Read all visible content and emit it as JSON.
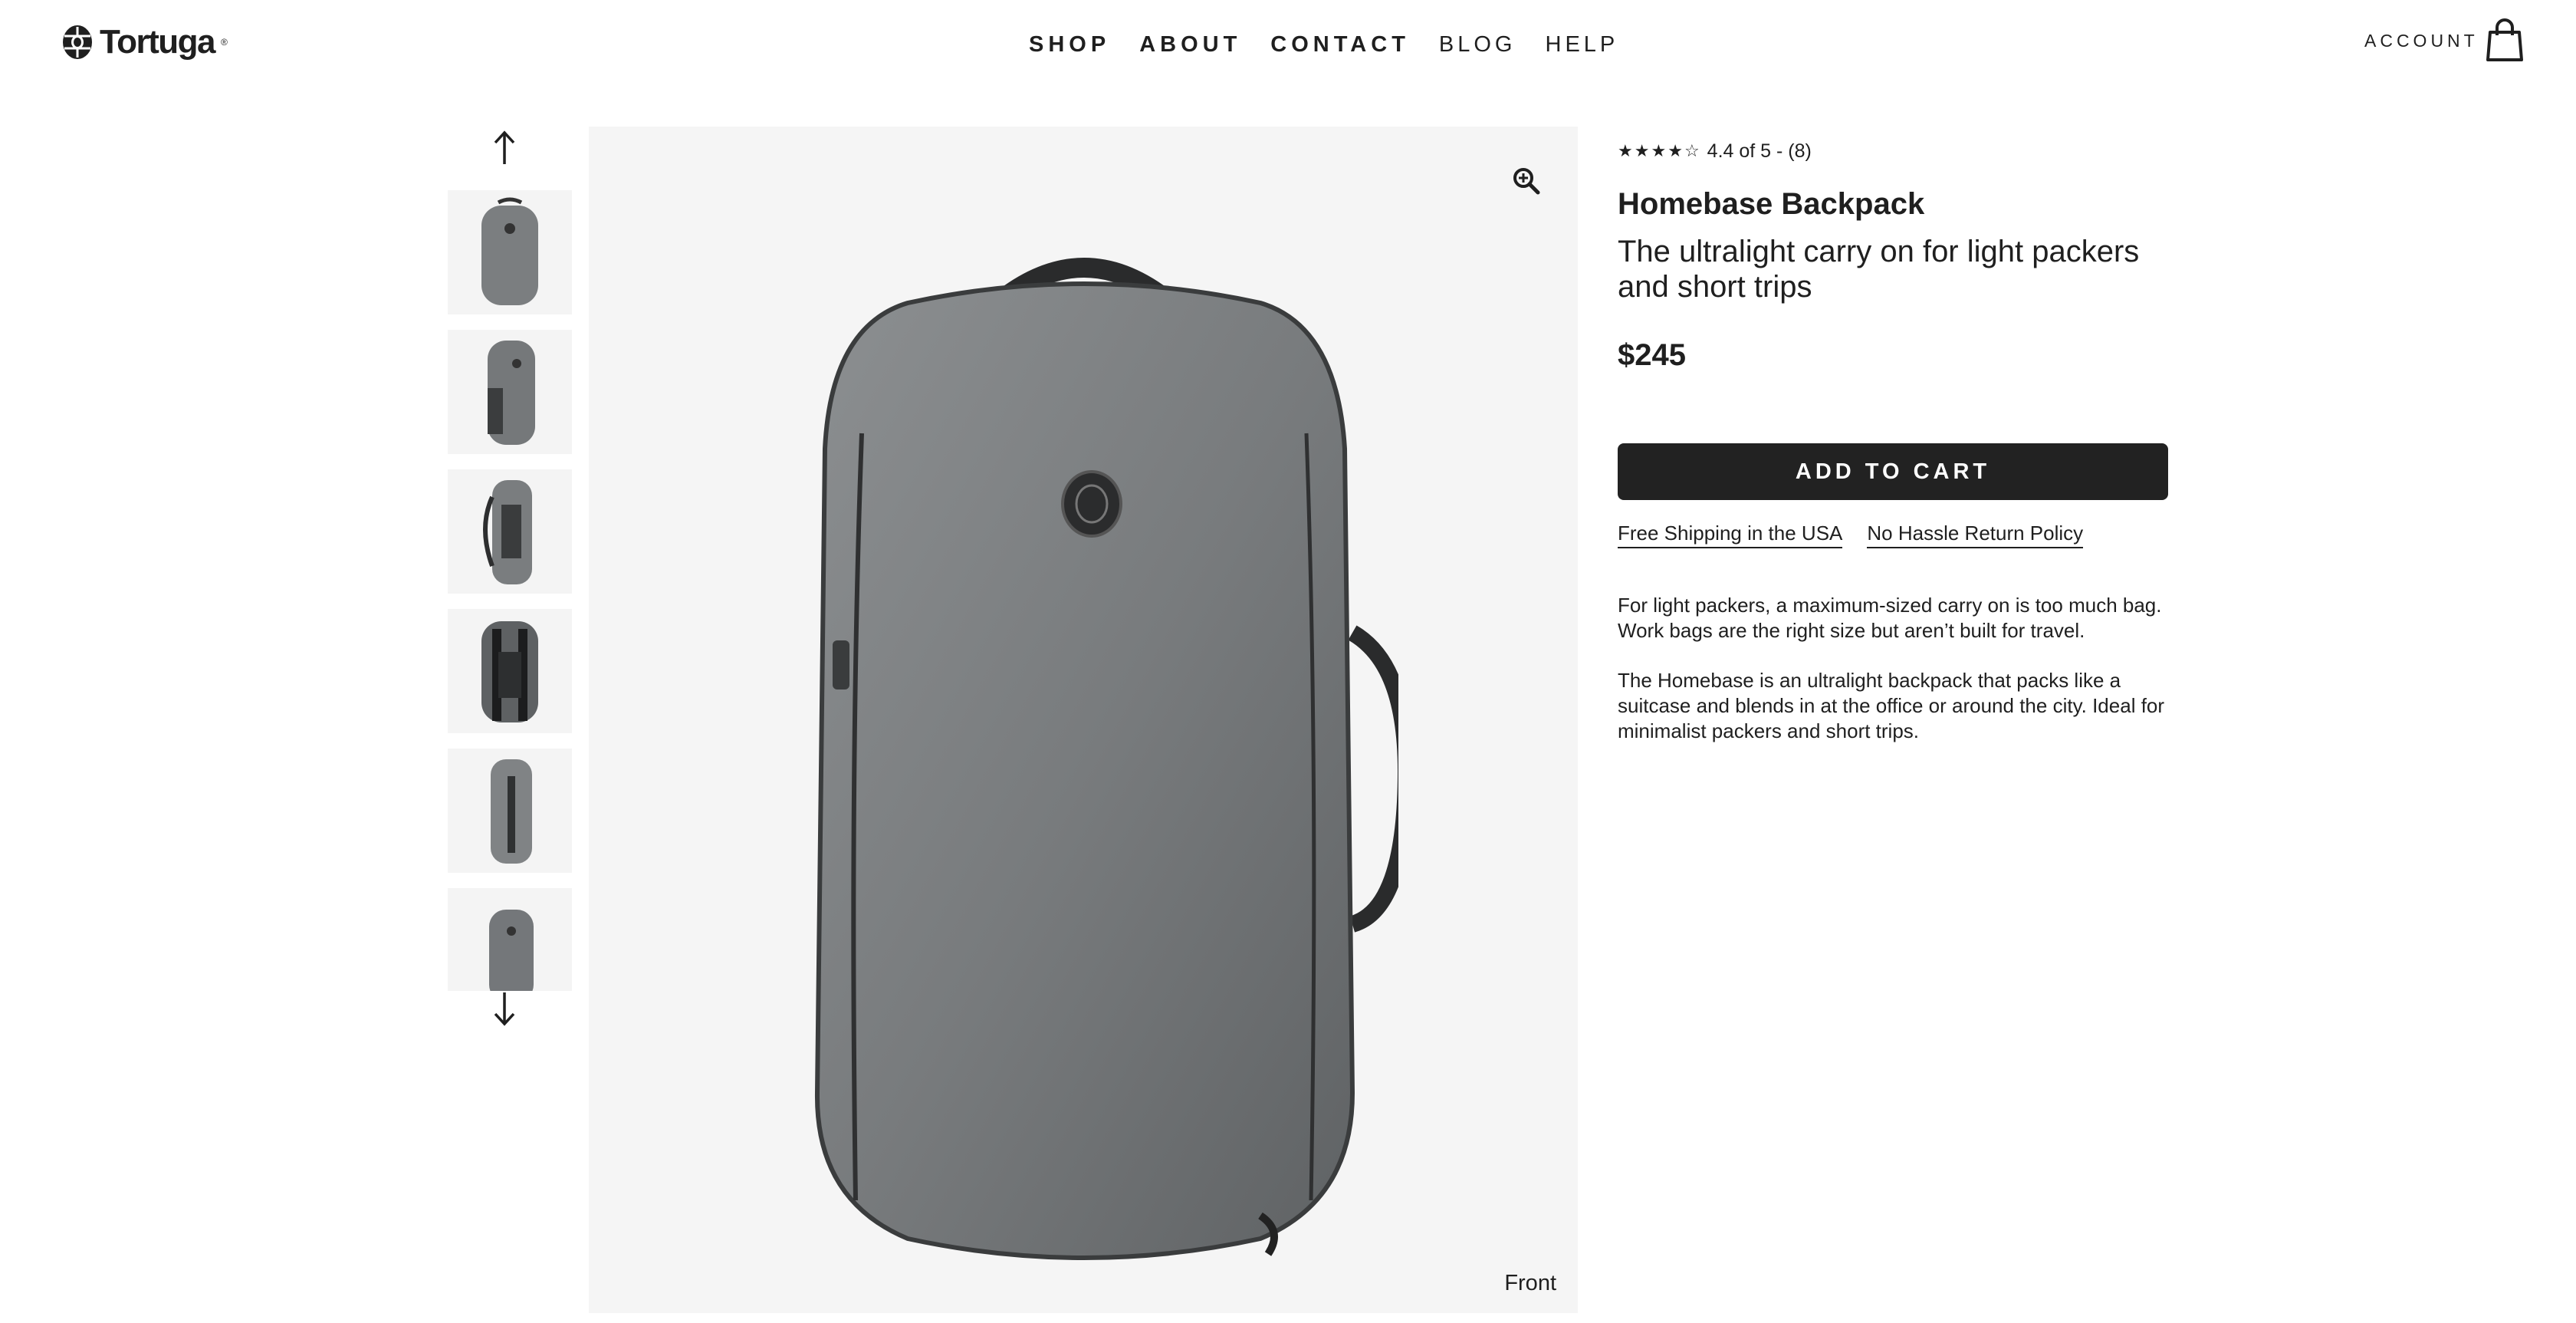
{
  "brand": {
    "name": "Tortuga",
    "trademark": "®",
    "logo_icon": "turtle-shell-icon"
  },
  "nav": {
    "items": [
      "SHOP",
      "ABOUT",
      "CONTACT",
      "BLOG",
      "HELP"
    ]
  },
  "account_label": "ACCOUNT",
  "cart_icon": "shopping-bag-icon",
  "gallery": {
    "caption": "Front",
    "up_icon": "arrow-up-icon",
    "down_icon": "arrow-down-icon",
    "zoom_icon": "zoom-in-icon",
    "thumbnail_count": 6,
    "thumbnail_views": [
      "front",
      "front-angle",
      "side",
      "back-harness",
      "side-handle",
      "front-small"
    ]
  },
  "product": {
    "rating_stars": 4.4,
    "rating_text": "4.4 of 5 - (8)",
    "title": "Homebase Backpack",
    "subtitle": "The ultralight carry on for light packers and short trips",
    "price": "$245",
    "add_to_cart": "ADD TO CART",
    "links": [
      "Free Shipping in the USA",
      "No Hassle Return Policy"
    ],
    "description": [
      "For light packers, a maximum-sized carry on is too much bag. Work bags are the right size but aren’t built for travel.",
      "The Homebase is an ultralight backpack that packs like a suitcase and blends in at the office or around the city. Ideal for minimalist packers and short trips."
    ]
  },
  "colors": {
    "text": "#1f1f1f",
    "button_bg": "#222222",
    "image_bg": "#f5f5f5",
    "pack_gray": "#75787a"
  }
}
